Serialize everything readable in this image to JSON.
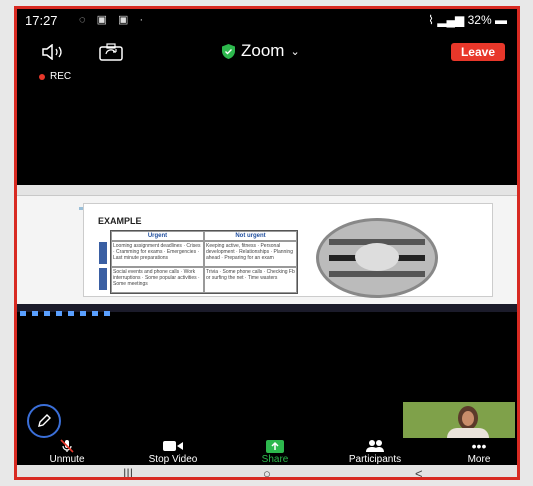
{
  "status": {
    "time": "17:27",
    "battery": "32%"
  },
  "header": {
    "title": "Zoom",
    "leave_label": "Leave",
    "rec_label": "REC"
  },
  "slide": {
    "example_label": "EXAMPLE",
    "col1": "Urgent",
    "col2": "Not urgent",
    "q1": "Looming assignment deadlines · Crises · Cramming for exams · Emergencies · Last minute preparations",
    "q2": "Keeping active, fitness · Personal development · Relationships · Planning ahead · Preparing for an exam",
    "q3": "Social events and phone calls · Work interruptions · Some popular activities · Some meetings",
    "q4": "Trivia · Some phone calls · Checking Fb or surfing the net · Time wasters"
  },
  "toolbar": {
    "unmute": "Unmute",
    "stop_video": "Stop Video",
    "share": "Share",
    "participants": "Participants",
    "more": "More"
  },
  "colors": {
    "accent_red": "#e8372a",
    "share_green": "#2db84d",
    "pen_blue": "#3b6fd8"
  }
}
